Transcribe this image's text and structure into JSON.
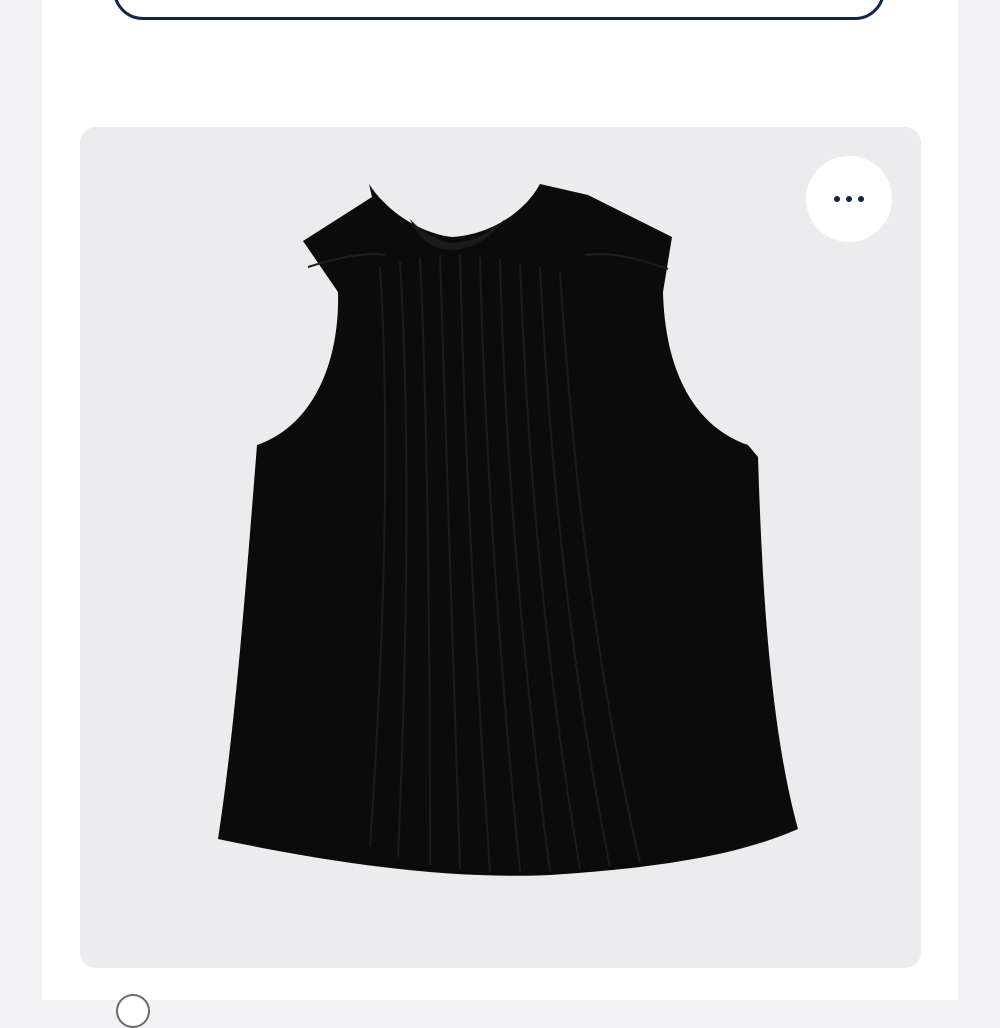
{
  "colors": {
    "page_background": "#f2f2f4",
    "sheet": "#ffffff",
    "top_field_border": "#10264a",
    "card_background": "#ececee",
    "product": "#0b0b0b",
    "more_dots": "#10264a"
  },
  "top_field": {
    "value": ""
  },
  "product": {
    "image": "black-sleeveless-pleated-mock-neck-top",
    "more_button_icon": "ellipsis-horizontal-icon"
  },
  "bottom_peek": {
    "icon": "circle-avatar-icon"
  }
}
